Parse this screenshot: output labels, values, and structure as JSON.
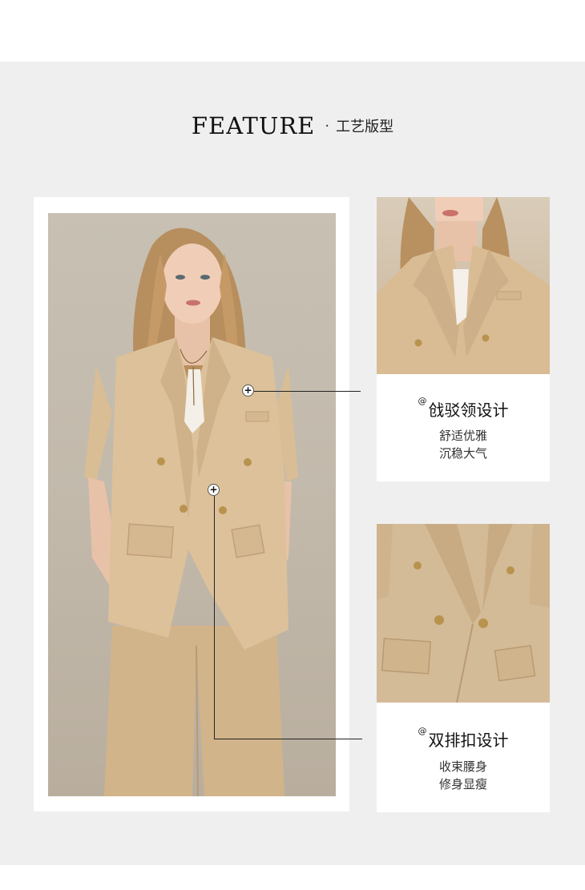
{
  "header": {
    "title": "FEATURE",
    "separator": "·",
    "subtitle": "工艺版型"
  },
  "hotspots": [
    {
      "label": "+"
    },
    {
      "label": "+"
    }
  ],
  "features": [
    {
      "marker": "@",
      "title": "戗驳领设计",
      "lines": [
        "舒适优雅",
        "沉稳大气"
      ]
    },
    {
      "marker": "@",
      "title": "双排扣设计",
      "lines": [
        "收束腰身",
        "修身显瘦"
      ]
    }
  ],
  "colors": {
    "background": "#efefef",
    "card": "#ffffff",
    "suit": "#d8bc94",
    "button_gold": "#b8934e"
  }
}
